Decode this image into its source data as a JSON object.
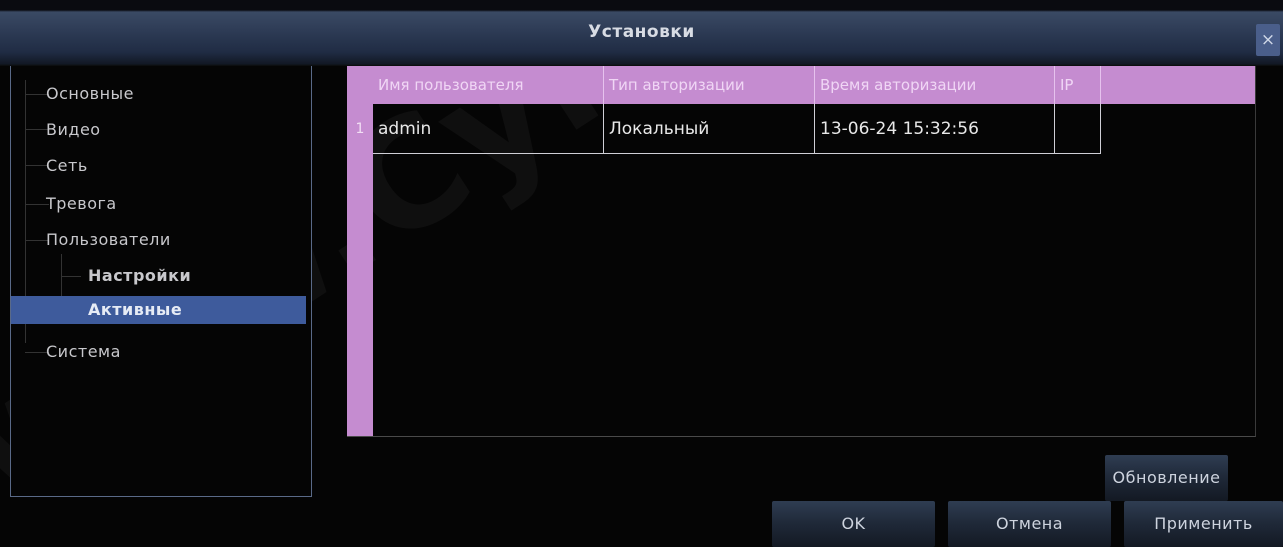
{
  "window": {
    "title": "Установки",
    "close_label": "×"
  },
  "sidebar": {
    "items": [
      {
        "label": "Основные",
        "level": 0
      },
      {
        "label": "Видео",
        "level": 0
      },
      {
        "label": "Сеть",
        "level": 0
      },
      {
        "label": "Тревога",
        "level": 0
      },
      {
        "label": "Пользователи",
        "level": 0
      },
      {
        "label": "Настройки",
        "level": 1
      },
      {
        "label": "Активные",
        "level": 1,
        "selected": true
      },
      {
        "label": "Система",
        "level": 0
      }
    ]
  },
  "table": {
    "columns": [
      "Имя пользователя",
      "Тип авторизации",
      "Время авторизации",
      "IP"
    ],
    "rows": [
      {
        "num": "1",
        "cells": [
          "admin",
          "Локальный",
          "13-06-24 15:32:56",
          ""
        ]
      }
    ]
  },
  "buttons": {
    "refresh": "Обновление",
    "ok": "OK",
    "cancel": "Отмена",
    "apply": "Применить"
  },
  "watermark": "www.Cyfron.ru",
  "colors": {
    "table_header_bg": "#c58cd0",
    "selected_item_bg": "#3e5b9c",
    "titlebar_bg": "#2e3c56"
  }
}
